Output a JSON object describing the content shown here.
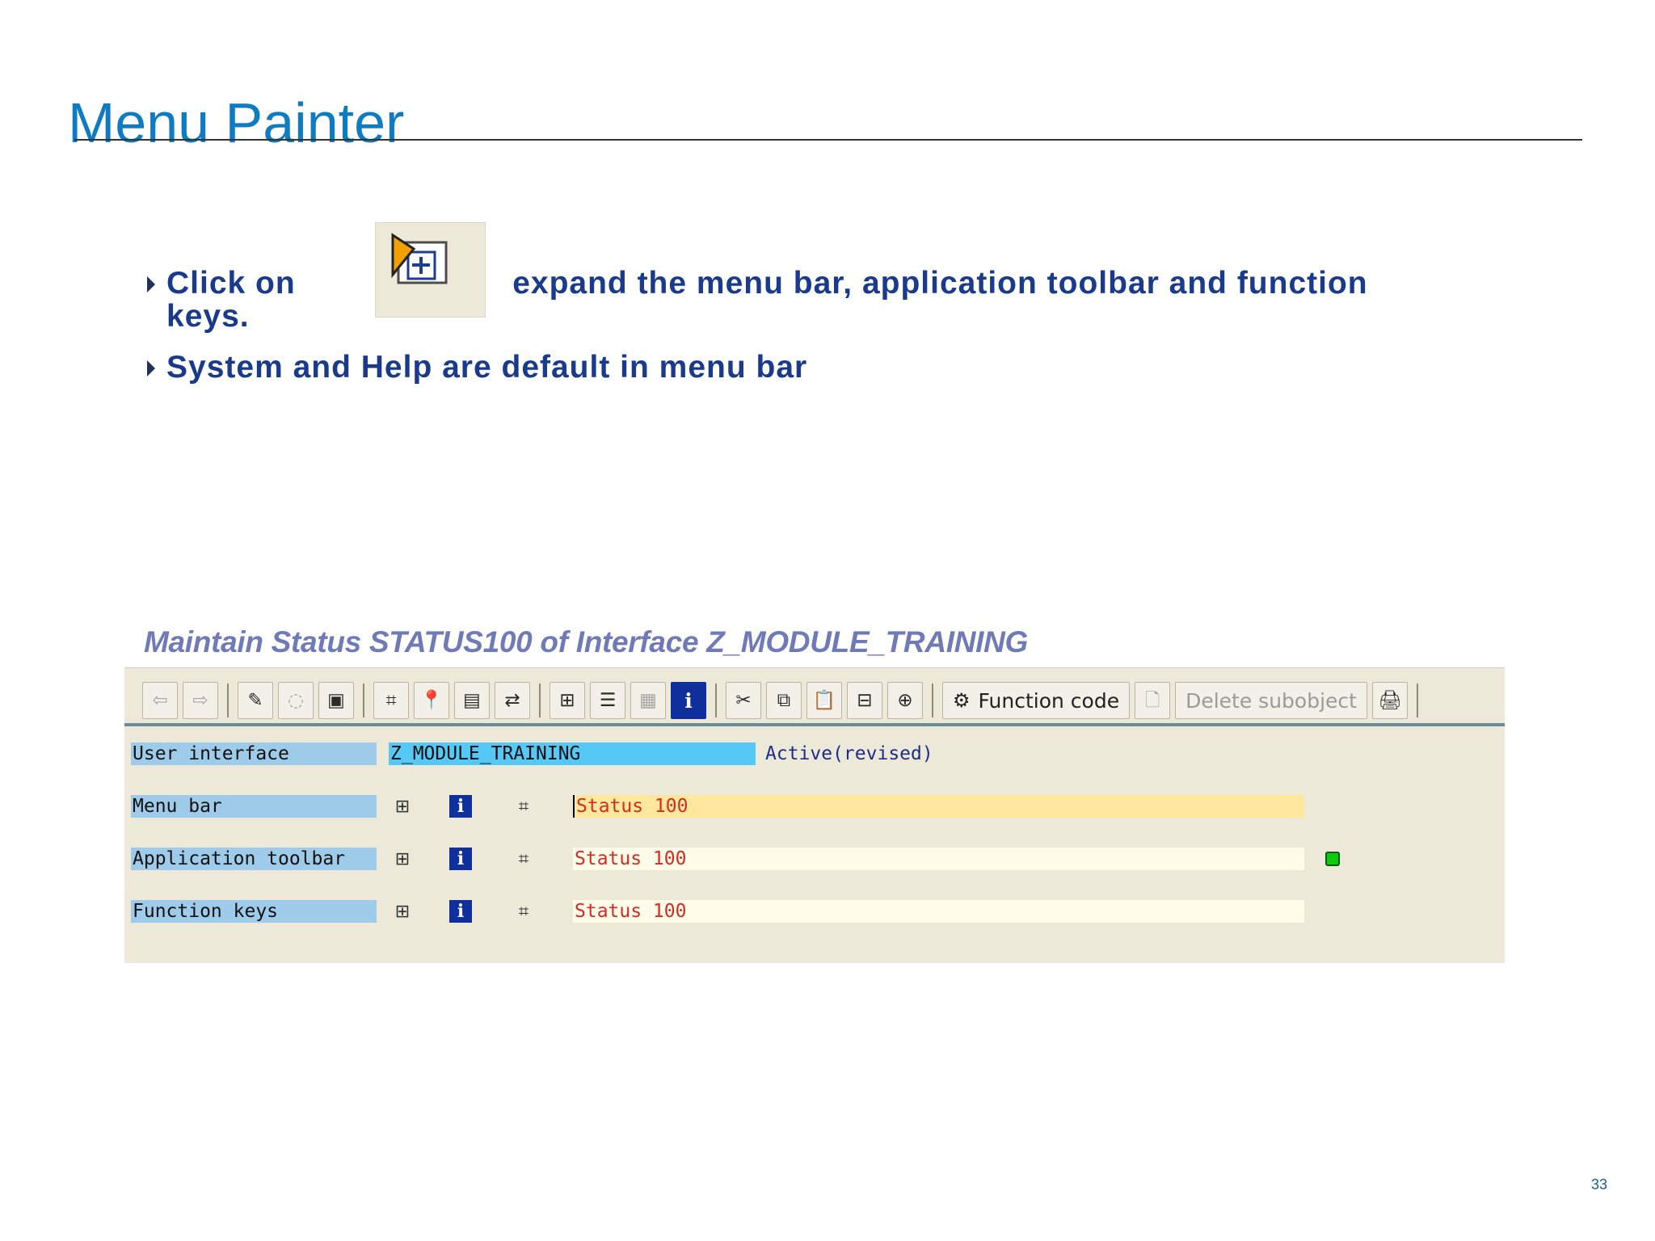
{
  "slide": {
    "title": "Menu Painter",
    "page_number": "33"
  },
  "bullets": [
    {
      "before_icon": "Click on",
      "after_icon": " expand the menu bar, application toolbar and function",
      "wrap": "keys."
    },
    {
      "text": "System and Help are default in menu bar"
    }
  ],
  "icons": {
    "inline": "expand-all-icon",
    "toolbar": [
      "back-arrow-icon",
      "forward-arrow-icon",
      "edit-pencil-icon",
      "display-change-icon",
      "object-list-icon",
      "hierarchy-icon",
      "pin-icon",
      "display-table-icon",
      "network-icon",
      "tree-icon",
      "stack-icon",
      "disabled-list-icon",
      "info-icon",
      "cut-icon",
      "copy-icon",
      "paste-icon",
      "delete-row-icon",
      "insert-row-icon",
      "function-code-icon",
      "new-page-icon",
      "print-icon"
    ]
  },
  "sap": {
    "window_title": "Maintain Status STATUS100 of Interface Z_MODULE_TRAINING",
    "toolbar": {
      "function_code_label": "Function code",
      "delete_subobject_label": "Delete subobject"
    },
    "rows": [
      {
        "label": "User interface",
        "value": "Z_MODULE_TRAINING",
        "status": "Active(revised)"
      },
      {
        "label": "Menu bar",
        "field": "Status 100"
      },
      {
        "label": "Application toolbar",
        "field": "Status 100"
      },
      {
        "label": "Function keys",
        "field": "Status 100"
      }
    ]
  },
  "colors": {
    "title": "#0f7bc2",
    "bullet_text": "#1a3a8c",
    "sap_title": "#6f7ab6",
    "field_text": "#d62b1f",
    "green_light": "#12c80f"
  }
}
